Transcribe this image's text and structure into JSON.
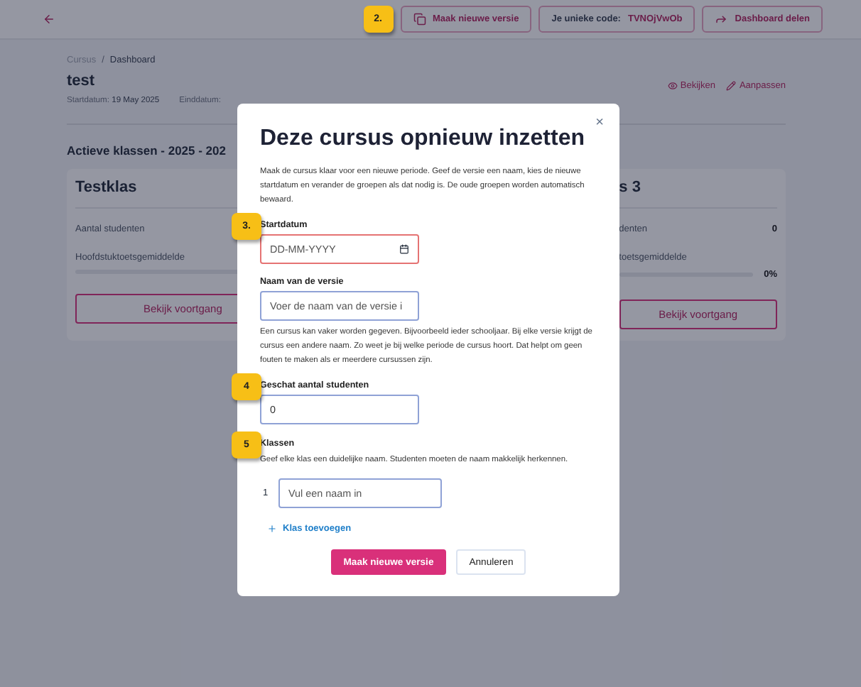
{
  "header": {
    "step": "2.",
    "buttons": [
      {
        "kind": "copy",
        "label": "Maak nieuwe versie"
      },
      {
        "kind": "code",
        "label": "Je unieke code:",
        "code": "TVNOjVwOb"
      },
      {
        "kind": "share",
        "label": "Dashboard delen"
      }
    ]
  },
  "breadcrumb": [
    "Cursus",
    "Dashboard"
  ],
  "breadcrumb_separator": "/",
  "title": "test",
  "dates": [
    {
      "label": "Startdatum:",
      "value": "19 May 2025"
    },
    {
      "label": "Einddatum:"
    }
  ],
  "actions": [
    {
      "kind": "view",
      "label": "Bekijken"
    },
    {
      "kind": "edit",
      "label": "Aanpassen"
    }
  ],
  "section_title": "Actieve klassen - 2025 - 202",
  "cards": [
    {
      "title": "Testklas",
      "students_label": "Aantal studenten",
      "average_label": "Hoofdstuktoetsgemiddelde",
      "level": 0,
      "button": "Bekijk voortgang"
    },
    {
      "title": "s 3",
      "students_label": "denten",
      "students_value": "0",
      "average_label": "toetsgemiddelde",
      "level": 0,
      "average_value": "0%",
      "button": "Bekijk voortgang"
    }
  ],
  "modal": {
    "title": "Deze cursus opnieuw inzetten",
    "close": "×",
    "description": "Maak de cursus klaar voor een nieuwe periode. Geef de versie een naam, kies de nieuwe startdatum en verander de groepen als dat nodig is. De oude groepen worden automatisch bewaard.",
    "fields": [
      {
        "step": "3.",
        "kind": "date",
        "label": "Startdatum",
        "placeholder": "DD-MM-YYYY",
        "invalid": true
      },
      {
        "kind": "text",
        "label": "Naam van de versie",
        "placeholder": "Voer de naam van de versie i",
        "invalid": false,
        "note": "Een cursus kan vaker worden gegeven. Bijvoorbeeld ieder schooljaar. Bij elke versie krijgt de cursus een andere naam. Zo weet je bij welke periode de cursus hoort. Dat helpt om geen fouten te maken als er meerdere cursussen zijn."
      },
      {
        "step": "4",
        "kind": "number",
        "label": "Geschat aantal studenten",
        "value": "0",
        "invalid": false
      }
    ],
    "classes": {
      "step": "5",
      "label": "Klassen",
      "help": "Geef elke klas een duidelijke naam. Studenten moeten de naam makkelijk herkennen.",
      "rows": [
        {
          "number": "1",
          "placeholder": "Vul een naam in"
        }
      ],
      "add": "Klas toevoegen"
    },
    "buttons": [
      {
        "kind": "primary",
        "label": "Maak nieuwe versie"
      },
      {
        "kind": "secondary",
        "label": "Annuleren"
      }
    ]
  }
}
